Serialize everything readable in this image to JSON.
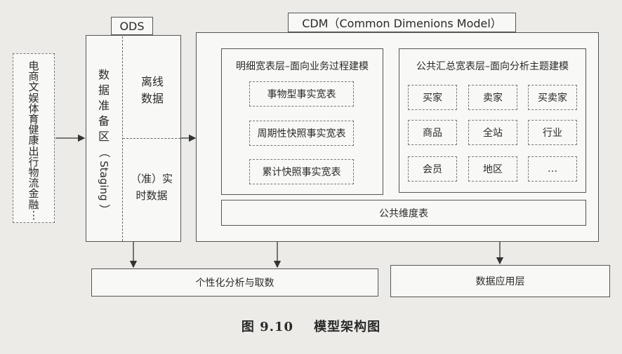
{
  "sources": {
    "items": [
      "电",
      "商",
      "文",
      "娱",
      "体",
      "育",
      "健",
      "康",
      "出",
      "行",
      "物",
      "流",
      "金",
      "融",
      "⋮"
    ]
  },
  "ods": {
    "title": "ODS",
    "staging_chars": [
      "数",
      "据",
      "准",
      "备",
      "区",
      "（",
      "Staging",
      "）"
    ],
    "offline": [
      "离线",
      "数据"
    ],
    "realtime": [
      "（准）实",
      "时数据"
    ]
  },
  "cdm": {
    "title": "CDM（Common Dimenions Model）",
    "detail": {
      "title": "明细宽表层–面向业务过程建模",
      "items": [
        "事物型事实宽表",
        "周期性快照事实宽表",
        "累计快照事实宽表"
      ]
    },
    "summary": {
      "title": "公共汇总宽表层–面向分析主题建模",
      "grid": [
        "买家",
        "卖家",
        "买卖家",
        "商品",
        "全站",
        "行业",
        "会员",
        "地区",
        "…"
      ]
    },
    "dim_table": "公共维度表"
  },
  "outputs": {
    "personal": "个性化分析与取数",
    "app_layer": "数据应用层"
  },
  "caption": "图 9.10    模型架构图"
}
